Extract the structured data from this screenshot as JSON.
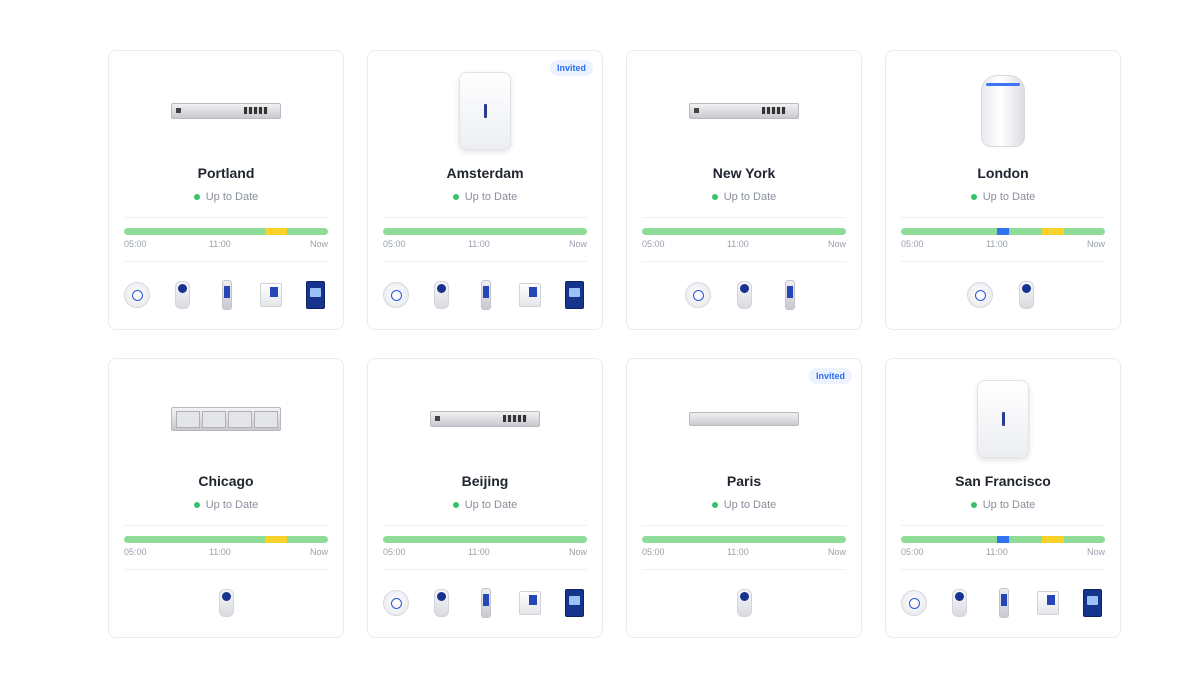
{
  "timeline_labels": [
    "05:00",
    "11:00",
    "Now"
  ],
  "status_color": "#35c26a",
  "bar_colors": {
    "ok": "#8fdc98",
    "warning": "#f8d22a",
    "event": "#2f72f2"
  },
  "sites": [
    {
      "name": "Portland",
      "status": "Up to Date",
      "badge": "",
      "device": "switch-icon",
      "segments": [
        {
          "color": "warning",
          "from": 0.69,
          "to": 0.8
        }
      ],
      "clients": [
        "access-point-icon",
        "camera-icon",
        "door-reader-icon",
        "access-hub-icon",
        "display-icon"
      ]
    },
    {
      "name": "Amsterdam",
      "status": "Up to Date",
      "badge": "Invited",
      "device": "wall-gateway-icon",
      "segments": [],
      "clients": [
        "access-point-icon",
        "camera-icon",
        "door-reader-icon",
        "access-hub-icon",
        "display-icon"
      ]
    },
    {
      "name": "New York",
      "status": "Up to Date",
      "badge": "",
      "device": "switch-icon",
      "segments": [],
      "clients": [
        "access-point-icon",
        "camera-icon",
        "door-reader-icon"
      ]
    },
    {
      "name": "London",
      "status": "Up to Date",
      "badge": "",
      "device": "tower-gateway-icon",
      "segments": [
        {
          "color": "event",
          "from": 0.47,
          "to": 0.53
        },
        {
          "color": "warning",
          "from": 0.69,
          "to": 0.8
        }
      ],
      "clients": [
        "access-point-icon",
        "camera-icon"
      ]
    },
    {
      "name": "Chicago",
      "status": "Up to Date",
      "badge": "",
      "device": "nvr-icon",
      "segments": [
        {
          "color": "warning",
          "from": 0.69,
          "to": 0.8
        }
      ],
      "clients": [
        "camera-icon"
      ]
    },
    {
      "name": "Beijing",
      "status": "Up to Date",
      "badge": "",
      "device": "switch-icon",
      "segments": [],
      "clients": [
        "access-point-icon",
        "camera-icon",
        "door-reader-icon",
        "access-hub-icon",
        "display-icon"
      ]
    },
    {
      "name": "Paris",
      "status": "Up to Date",
      "badge": "Invited",
      "device": "rack-server-icon",
      "segments": [],
      "clients": [
        "camera-icon"
      ]
    },
    {
      "name": "San Francisco",
      "status": "Up to Date",
      "badge": "",
      "device": "wall-gateway-icon",
      "segments": [
        {
          "color": "event",
          "from": 0.47,
          "to": 0.53
        },
        {
          "color": "warning",
          "from": 0.69,
          "to": 0.8
        }
      ],
      "clients": [
        "access-point-icon",
        "camera-icon",
        "door-reader-icon",
        "access-hub-icon",
        "display-icon"
      ]
    }
  ]
}
